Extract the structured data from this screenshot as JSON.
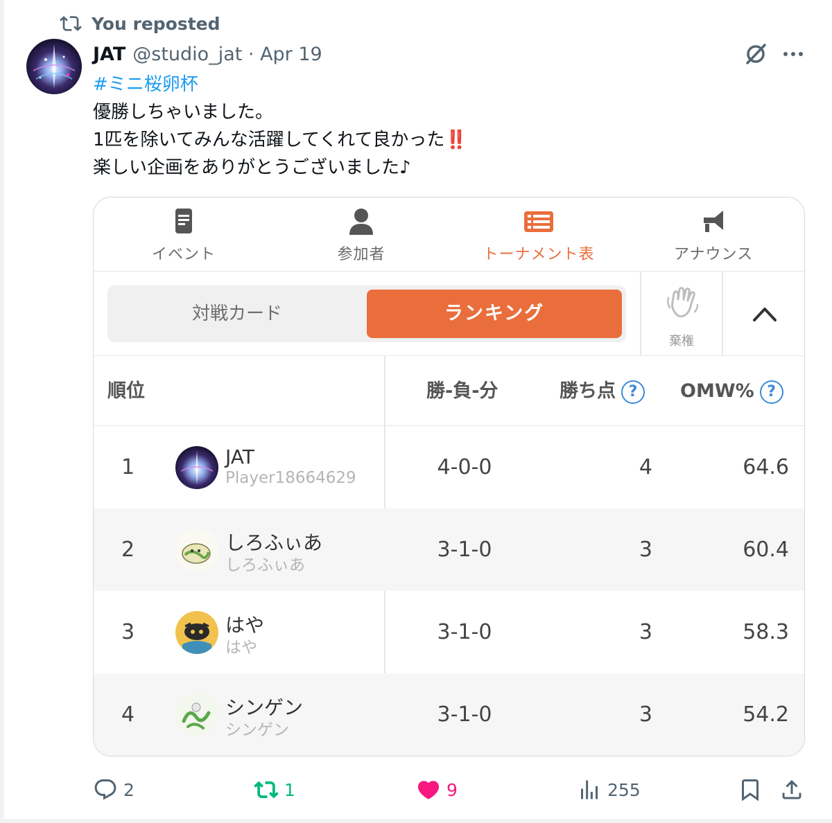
{
  "repost": {
    "label": "You reposted"
  },
  "tweet": {
    "author_name": "JAT",
    "handle_date": "@studio_jat · Apr 19",
    "hashtag": "#ミニ桜卵杯",
    "line1": "優勝しちゃいました。",
    "line2": "1匹を除いてみんな活躍してくれて良かった",
    "line2_emoji": "‼️",
    "line3": "楽しい企画をありがとうございました♪"
  },
  "card": {
    "tabs": [
      {
        "label": "イベント",
        "icon": "document-icon"
      },
      {
        "label": "参加者",
        "icon": "person-icon"
      },
      {
        "label": "トーナメント表",
        "icon": "bracket-icon",
        "active": true
      },
      {
        "label": "アナウンス",
        "icon": "megaphone-icon"
      }
    ],
    "segment": {
      "left": "対戦カード",
      "right": "ランキング"
    },
    "forfeit_label": "棄権",
    "table": {
      "headers": {
        "rank": "順位",
        "record": "勝-負-分",
        "points": "勝ち点",
        "omw": "OMW%",
        "help": "?"
      },
      "rows": [
        {
          "rank": "1",
          "name": "JAT",
          "sub": "Player18664629",
          "record": "4-0-0",
          "points": "4",
          "omw": "64.6"
        },
        {
          "rank": "2",
          "name": "しろふぃあ",
          "sub": "しろふぃあ",
          "record": "3-1-0",
          "points": "3",
          "omw": "60.4"
        },
        {
          "rank": "3",
          "name": "はや",
          "sub": "はや",
          "record": "3-1-0",
          "points": "3",
          "omw": "58.3"
        },
        {
          "rank": "4",
          "name": "シンゲン",
          "sub": "シンゲン",
          "record": "3-1-0",
          "points": "3",
          "omw": "54.2"
        }
      ]
    }
  },
  "actions": {
    "replies": "2",
    "reposts": "1",
    "likes": "9",
    "views": "255"
  },
  "colors": {
    "accent": "#ea6e3c",
    "link": "#1d9bf0",
    "repost_green": "#00ba7c",
    "like_pink": "#f91880",
    "muted": "#536471"
  }
}
